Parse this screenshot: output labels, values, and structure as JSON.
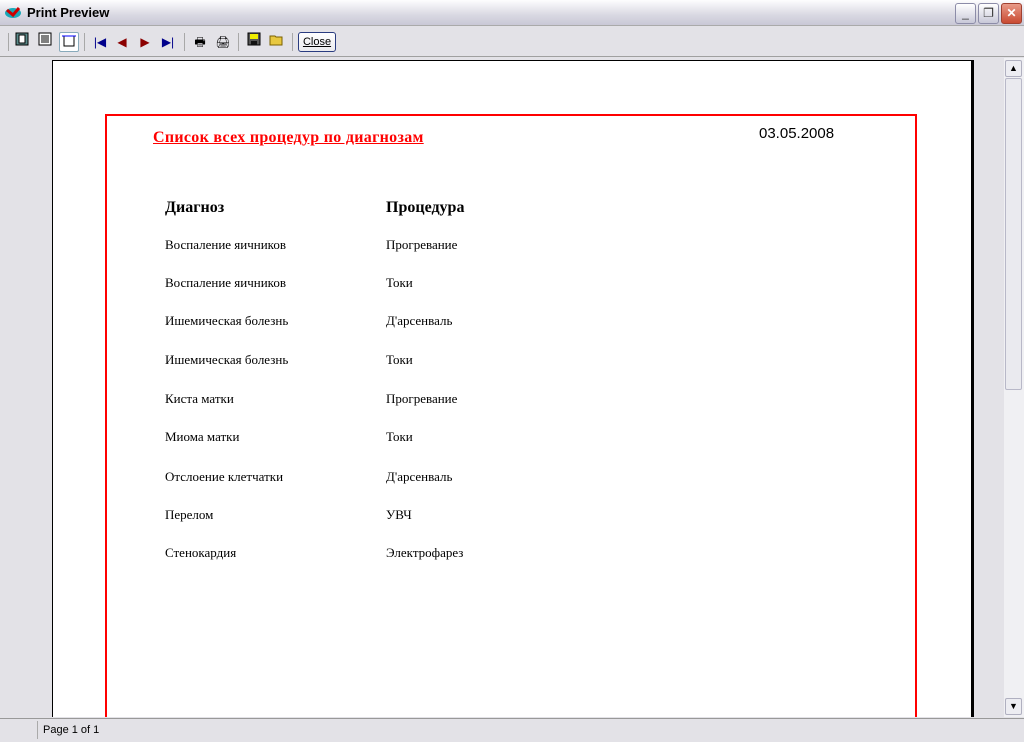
{
  "window": {
    "title": "Print Preview"
  },
  "toolbar": {
    "close_label": "Close"
  },
  "report": {
    "title": "Список всех процедур по диагнозам",
    "date": "03.05.2008",
    "headers": [
      "Диагноз",
      "Процедура"
    ],
    "rows": [
      [
        "Воспаление яичников",
        "Прогревание"
      ],
      [
        "Воспаление яичников",
        "Токи"
      ],
      [
        "Ишемическая болезнь",
        "Д'арсенваль"
      ],
      [
        "Ишемическая болезнь",
        "Токи"
      ],
      [
        "Киста матки",
        "Прогревание"
      ],
      [
        "Миома матки",
        "Токи"
      ],
      [
        "Отслоение клетчатки",
        "Д'арсенваль"
      ],
      [
        "Перелом",
        "УВЧ"
      ],
      [
        "Стенокардия",
        "Электрофарез"
      ]
    ]
  },
  "status": {
    "page": "Page 1 of 1"
  }
}
